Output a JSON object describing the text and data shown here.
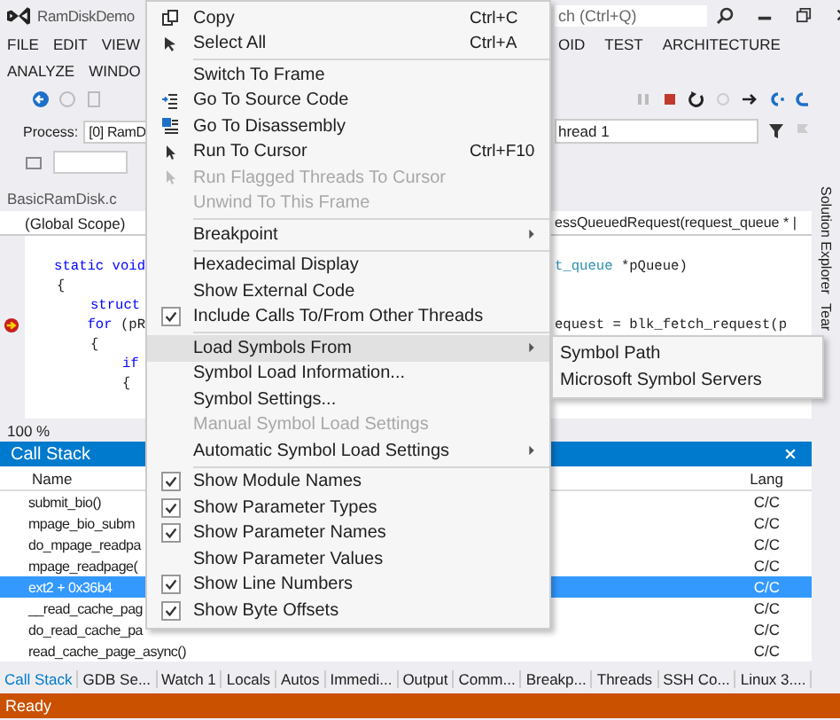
{
  "window": {
    "title": "RamDiskDemo",
    "search_placeholder": "ch (Ctrl+Q)"
  },
  "menubar": {
    "row_1_left": [
      "FILE",
      "EDIT",
      "VIEW"
    ],
    "row_1_right": [
      "OID",
      "TEST",
      "ARCHITECTURE"
    ],
    "row_2_left": [
      "ANALYZE",
      "WINDO"
    ]
  },
  "debug_location": {
    "process_label": "Process:",
    "process_value": "[0] RamD",
    "thread_value": "hread 1"
  },
  "editor": {
    "tab": "BasicRamDisk.c",
    "scope_left": "(Global Scope)",
    "scope_right": "essQueuedRequest(request_queue * |",
    "zoom": "100 %",
    "lines": [
      {
        "left": [
          {
            "t": "static void",
            "kind": "keyword"
          }
        ],
        "right": [
          {
            "t": "t_queue",
            "kind": "type"
          },
          {
            "t": " *pQueue)",
            "kind": "plain"
          }
        ],
        "breakpoint": false
      },
      {
        "left": [
          {
            "t": "{",
            "kind": "plain"
          }
        ],
        "breakpoint": false
      },
      {
        "left": [
          {
            "t": "struct",
            "kind": "keyword"
          }
        ],
        "breakpoint": false
      },
      {
        "left": [
          {
            "t": "for",
            "kind": "keyword"
          },
          {
            "t": " (pR",
            "kind": "plain"
          }
        ],
        "right": [
          {
            "t": "equest = blk_fetch_request(p",
            "kind": "plain"
          }
        ],
        "breakpoint": true
      },
      {
        "left": [
          {
            "t": "{",
            "kind": "plain"
          }
        ],
        "breakpoint": false
      },
      {
        "left": [
          {
            "t": "if",
            "kind": "keyword"
          }
        ],
        "breakpoint": false
      },
      {
        "left": [
          {
            "t": "{",
            "kind": "plain"
          }
        ],
        "breakpoint": false
      }
    ]
  },
  "side_tabs": [
    "Solution Explorer",
    "Tear"
  ],
  "call_stack": {
    "title": "Call Stack",
    "columns": [
      "Name",
      "Lang"
    ],
    "rows": [
      {
        "name": "submit_bio()",
        "lang": "C/C",
        "selected": false
      },
      {
        "name": "mpage_bio_subm",
        "lang": "C/C",
        "selected": false
      },
      {
        "name": "do_mpage_readpa",
        "lang": "C/C",
        "selected": false
      },
      {
        "name": "mpage_readpage(",
        "lang": "C/C",
        "selected": false
      },
      {
        "name": "ext2 + 0x36b4",
        "lang": "C/C",
        "selected": true
      },
      {
        "name": "__read_cache_pag",
        "lang": "C/C",
        "selected": false
      },
      {
        "name": "do_read_cache_pa",
        "lang": "C/C",
        "selected": false
      },
      {
        "name": "read_cache_page_async()",
        "lang": "C/C",
        "selected": false
      }
    ]
  },
  "bottom_tabs": [
    {
      "label": "Call Stack",
      "selected": true
    },
    {
      "label": "GDB Se...",
      "selected": false
    },
    {
      "label": "Watch 1",
      "selected": false
    },
    {
      "label": "Locals",
      "selected": false
    },
    {
      "label": "Autos",
      "selected": false
    },
    {
      "label": "Immedi...",
      "selected": false
    },
    {
      "label": "Output",
      "selected": false
    },
    {
      "label": "Comm...",
      "selected": false
    },
    {
      "label": "Breakp...",
      "selected": false
    },
    {
      "label": "Threads",
      "selected": false
    },
    {
      "label": "SSH Co...",
      "selected": false
    },
    {
      "label": "Linux 3....",
      "selected": false
    }
  ],
  "status_bar": "Ready",
  "context_menu": [
    {
      "kind": "item",
      "label": "Copy",
      "shortcut": "Ctrl+C",
      "checked": false,
      "disabled": false,
      "submenu": false,
      "selected": false
    },
    {
      "kind": "item",
      "label": "Select All",
      "shortcut": "Ctrl+A",
      "checked": false,
      "disabled": false,
      "submenu": false,
      "selected": false
    },
    {
      "kind": "separator"
    },
    {
      "kind": "item",
      "label": "Switch To Frame",
      "checked": false,
      "disabled": false,
      "submenu": false,
      "selected": false
    },
    {
      "kind": "item",
      "label": "Go To Source Code",
      "checked": false,
      "disabled": false,
      "submenu": false,
      "selected": false
    },
    {
      "kind": "item",
      "label": "Go To Disassembly",
      "checked": false,
      "disabled": false,
      "submenu": false,
      "selected": false
    },
    {
      "kind": "item",
      "label": "Run To Cursor",
      "shortcut": "Ctrl+F10",
      "checked": false,
      "disabled": false,
      "submenu": false,
      "selected": false
    },
    {
      "kind": "item",
      "label": "Run Flagged Threads To Cursor",
      "checked": false,
      "disabled": true,
      "submenu": false,
      "selected": false
    },
    {
      "kind": "item",
      "label": "Unwind To This Frame",
      "checked": false,
      "disabled": true,
      "submenu": false,
      "selected": false
    },
    {
      "kind": "separator"
    },
    {
      "kind": "item",
      "label": "Breakpoint",
      "checked": false,
      "disabled": false,
      "submenu": true,
      "selected": false
    },
    {
      "kind": "separator"
    },
    {
      "kind": "item",
      "label": "Hexadecimal Display",
      "checked": false,
      "disabled": false,
      "submenu": false,
      "selected": false
    },
    {
      "kind": "item",
      "label": "Show External Code",
      "checked": false,
      "disabled": false,
      "submenu": false,
      "selected": false
    },
    {
      "kind": "item",
      "label": "Include Calls To/From Other Threads",
      "checked": true,
      "disabled": false,
      "submenu": false,
      "selected": false
    },
    {
      "kind": "separator"
    },
    {
      "kind": "item",
      "label": "Load Symbols From",
      "checked": false,
      "disabled": false,
      "submenu": true,
      "selected": true
    },
    {
      "kind": "item",
      "label": "Symbol Load Information...",
      "checked": false,
      "disabled": false,
      "submenu": false,
      "selected": false
    },
    {
      "kind": "item",
      "label": "Symbol Settings...",
      "checked": false,
      "disabled": false,
      "submenu": false,
      "selected": false
    },
    {
      "kind": "item",
      "label": "Manual Symbol Load Settings",
      "checked": false,
      "disabled": true,
      "submenu": false,
      "selected": false
    },
    {
      "kind": "item",
      "label": "Automatic Symbol Load Settings",
      "checked": false,
      "disabled": false,
      "submenu": true,
      "selected": false
    },
    {
      "kind": "separator"
    },
    {
      "kind": "item",
      "label": "Show Module Names",
      "checked": true,
      "disabled": false,
      "submenu": false,
      "selected": false
    },
    {
      "kind": "item",
      "label": "Show Parameter Types",
      "checked": true,
      "disabled": false,
      "submenu": false,
      "selected": false
    },
    {
      "kind": "item",
      "label": "Show Parameter Names",
      "checked": true,
      "disabled": false,
      "submenu": false,
      "selected": false
    },
    {
      "kind": "item",
      "label": "Show Parameter Values",
      "checked": false,
      "disabled": false,
      "submenu": false,
      "selected": false
    },
    {
      "kind": "item",
      "label": "Show Line Numbers",
      "checked": true,
      "disabled": false,
      "submenu": false,
      "selected": false
    },
    {
      "kind": "item",
      "label": "Show Byte Offsets",
      "checked": true,
      "disabled": false,
      "submenu": false,
      "selected": false
    }
  ],
  "submenu": [
    {
      "label": "Symbol Path",
      "selected": false
    },
    {
      "label": "Microsoft Symbol Servers",
      "selected": false
    }
  ]
}
